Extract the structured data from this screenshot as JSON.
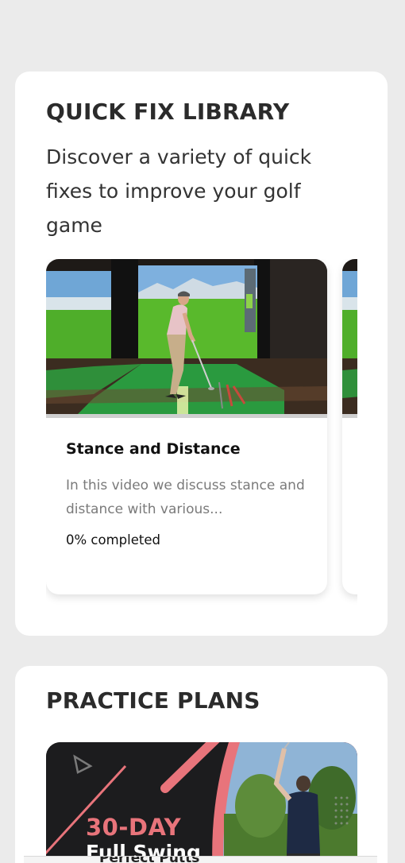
{
  "quick_fix": {
    "title": "QUICK FIX LIBRARY",
    "description": "Discover a variety of quick fixes to improve your golf game",
    "videos": [
      {
        "title": "Stance and Distance",
        "description": "In this video we discuss stance and distance with various...",
        "progress_text": "0% completed",
        "progress": 0
      }
    ]
  },
  "practice": {
    "title": "PRACTICE PLANS",
    "banner": {
      "headline": "30-DAY",
      "subline": "Full Swing"
    }
  },
  "bottom_bar": {
    "label": "Perfect Putts"
  },
  "colors": {
    "background": "#ebebeb",
    "card": "#ffffff",
    "accent_pink": "#e8747b",
    "banner_dark": "#1c1c1e",
    "turf_green": "#4caf2e"
  }
}
